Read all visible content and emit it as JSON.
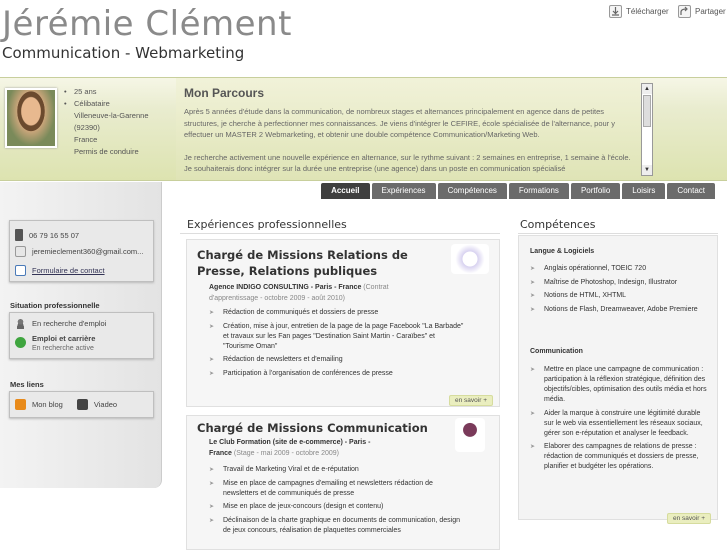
{
  "header": {
    "name": "Jérémie  Clément",
    "subtitle": "Communication - Webmarketing",
    "download_label": "Télécharger",
    "share_label": "Partager"
  },
  "profile": {
    "infos": [
      "25 ans",
      "Célibataire",
      "Villeneuve-la-Garenne",
      "(92390)",
      "France",
      "Permis de conduire"
    ]
  },
  "parcours": {
    "title": "Mon Parcours",
    "p1": "Après 5 années d'étude dans la communication, de nombreux stages et alternances principalement en agence dans de petites structures, je cherche à perfectionner mes connaissances. Je viens d'intégrer le CEFIRE, école spécialisée de l'alternance, pour y effectuer un MASTER 2 Webmarketing, et obtenir une double compétence Communication/Marketing Web.",
    "p2": "Je recherche activement une nouvelle expérience en alternance, sur le rythme suivant : 2 semaines en entreprise, 1 semaine à l'école. Je souhaiterais donc intégrer sur la durée une entreprise (une agence) dans un poste en communication spécialisé"
  },
  "nav": [
    "Accueil",
    "Expériences",
    "Compétences",
    "Formations",
    "Portfolio",
    "Loisirs",
    "Contact"
  ],
  "contact": {
    "phone": "06 79 16 55 07",
    "email": "jeremieclement360@gmail.com...",
    "form": "Formulaire de contact"
  },
  "situation": {
    "title": "Situation professionnelle",
    "status": "En recherche d'emploi",
    "job_title": "Emploi et carrière",
    "job_sub": "En recherche active"
  },
  "links": {
    "title": "Mes liens",
    "blog": "Mon blog",
    "viadeo": "Viadeo"
  },
  "experiences": {
    "title": "Expériences professionnelles",
    "more": "en savoir +",
    "items": [
      {
        "title1": "Chargé de Missions Relations de",
        "title2": "Presse, Relations publiques",
        "org1": "Agence INDIGO CONSULTING - Paris - France",
        "contract1": " (Contrat",
        "org2": "d'apprentissage - octobre 2009 - août 2010)",
        "bullets": [
          "Rédaction de communiqués et dossiers de presse",
          "Création, mise à jour, entretien de la page de la page Facebook \"La Barbade\" et travaux sur les Fan pages \"Destination Saint Martin - Caraïbes\" et \"Tourisme Oman\"",
          "Rédaction de newsletters et d'emailing",
          "Participation à l'organisation de conférences de presse"
        ]
      },
      {
        "title1": "Chargé de Missions Communication",
        "org1": "Le Club Formation (site de e-commerce) - Paris -",
        "org2a": "France",
        "org2b": " (Stage - mai 2009 - octobre 2009)",
        "bullets": [
          "Travail de Marketing Viral et de e-réputation",
          "Mise en place de campagnes d'emailing et newsletters rédaction de newsletters et de communiqués de presse",
          "Mise en place de jeux-concours (design et contenu)",
          "Déclinaison de la charte graphique en documents de communication, design de jeux concours, réalisation de plaquettes commerciales"
        ]
      }
    ]
  },
  "competences": {
    "title": "Compétences",
    "more": "en savoir +",
    "g1_title": "Langue & Logiciels",
    "g1": [
      "Anglais opérationnel, TOEIC 720",
      "Maîtrise de Photoshop, Indesign, Illustrator",
      "Notions de HTML, XHTML",
      "Notions de Flash, Dreamweaver, Adobe Premiere"
    ],
    "g2_title": "Communication",
    "g2": [
      "Mettre en place une campagne de communication : participation à la réflexion stratégique, définition des objectifs/cibles, optimisation des outils média et hors média.",
      "Aider la marque à construire une légitimité durable sur le web via essentiellement les réseaux sociaux, gérer son e-réputation et analyser le feedback.",
      "Elaborer des campagnes de relations de presse : rédaction de communiqués et dossiers de presse, planifier et budgéter les opérations."
    ]
  }
}
